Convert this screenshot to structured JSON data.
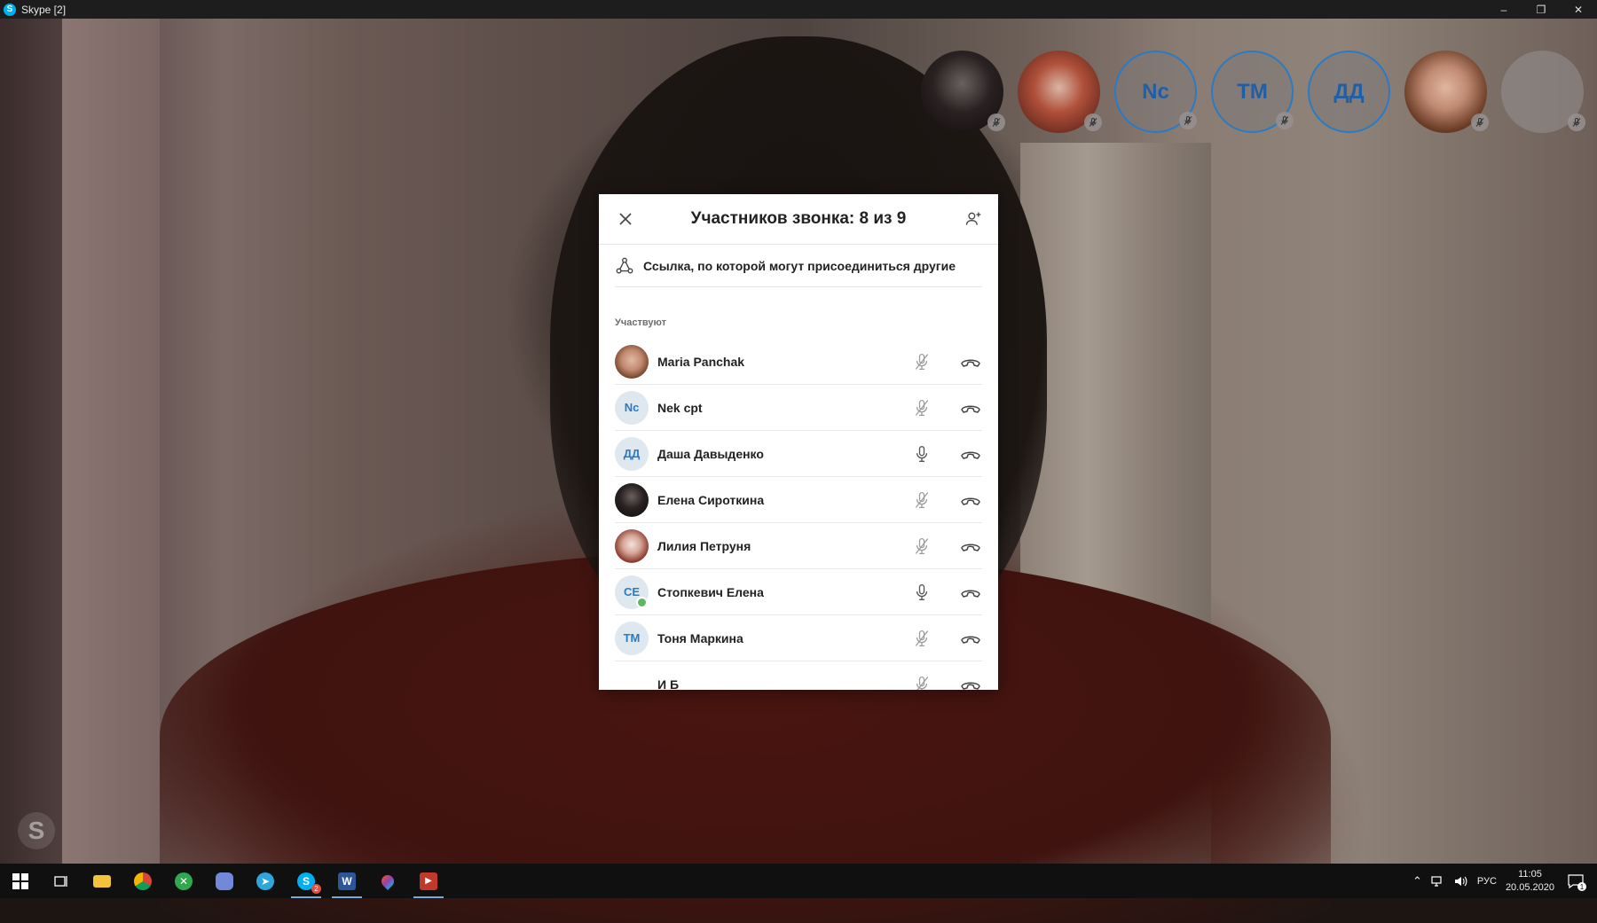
{
  "window": {
    "title": "Skype [2]",
    "app_icon_letter": "S",
    "minimize": "–",
    "restore": "❐",
    "close": "✕"
  },
  "bubbles": [
    {
      "type": "photo-dark",
      "initials": ""
    },
    {
      "type": "photo-girl",
      "initials": ""
    },
    {
      "type": "initials",
      "initials": "Nc"
    },
    {
      "type": "initials",
      "initials": "TM"
    },
    {
      "type": "initials",
      "initials": "ДД"
    },
    {
      "type": "photo-maria",
      "initials": ""
    },
    {
      "type": "empty",
      "initials": ""
    }
  ],
  "watermark_letter": "S",
  "dialog": {
    "title": "Участников звонка: 8 из 9",
    "share_link_text": "Ссылка, по которой могут присоединиться другие",
    "section_label": "Участвуют",
    "participants": [
      {
        "name": "Maria Panchak",
        "avatar": "photo-maria",
        "initials": "",
        "mic": "muted",
        "online": false
      },
      {
        "name": "Nek cpt",
        "avatar": "initials",
        "initials": "Nc",
        "mic": "muted",
        "online": false
      },
      {
        "name": "Даша Давыденко",
        "avatar": "initials",
        "initials": "ДД",
        "mic": "on",
        "online": false
      },
      {
        "name": "Елена Сироткина",
        "avatar": "photo-dark",
        "initials": "",
        "mic": "muted",
        "online": false
      },
      {
        "name": "Лилия Петруня",
        "avatar": "photo-girl",
        "initials": "",
        "mic": "muted",
        "online": false
      },
      {
        "name": "Стопкевич Елена",
        "avatar": "initials",
        "initials": "СЕ",
        "mic": "on",
        "online": true
      },
      {
        "name": "Тоня Маркина",
        "avatar": "initials",
        "initials": "ТМ",
        "mic": "muted",
        "online": false
      },
      {
        "name": "И Б",
        "avatar": "blank",
        "initials": "",
        "mic": "muted",
        "online": false
      }
    ]
  },
  "taskbar": {
    "apps": [
      "start",
      "task-view",
      "file-explorer",
      "chrome",
      "xbox",
      "discord",
      "telegram",
      "skype",
      "word",
      "droplet-app",
      "media-player"
    ],
    "skype_badge": "2",
    "language": "РУС",
    "time": "11:05",
    "date": "20.05.2020",
    "notification_count": "1"
  },
  "colors": {
    "accent": "#2a7bc4",
    "online": "#5cb85c",
    "taskbar": "#101010"
  }
}
